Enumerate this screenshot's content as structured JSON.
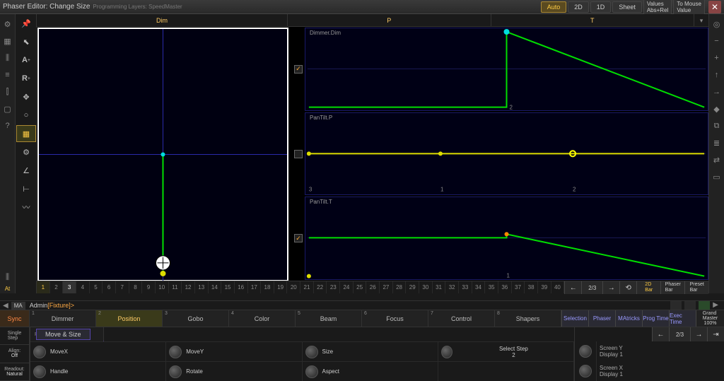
{
  "titlebar": {
    "title": "Phaser Editor: Change Size",
    "subtitle": "Programming Layers: SpeedMaster",
    "auto": "Auto",
    "btn_2d": "2D",
    "btn_1d": "1D",
    "btn_sheet": "Sheet",
    "values": "Values",
    "absrel": "Abs+Rel",
    "tomouse": "To Mouse",
    "value": "Value",
    "close": "✕"
  },
  "left_icons": {
    "at": "At"
  },
  "tool_icons": {
    "a": "A",
    "r": "R"
  },
  "tabs": {
    "dim": "Dim",
    "p": "P",
    "t": "T"
  },
  "graphs": {
    "dimmer": "Dimmer.Dim",
    "pantilt_p": "PanTilt.P",
    "pantilt_t": "PanTilt.T"
  },
  "timeline": {
    "page": "2/3",
    "bar_2d": "2D\nBar",
    "bar_phaser": "Phaser\nBar",
    "bar_preset": "Preset\nBar"
  },
  "cmd": {
    "ma": "MA",
    "admin": "Admin",
    "fixture": "[Fixture]>"
  },
  "attrs": {
    "sync": "Sync",
    "dimmer": "Dimmer",
    "position": "Position",
    "gobo": "Gobo",
    "color": "Color",
    "beam": "Beam",
    "focus": "Focus",
    "control": "Control",
    "shapers": "Shapers",
    "selection": "Selection",
    "phaser": "Phaser",
    "matricks": "MAtricks",
    "progtime": "Prog Time",
    "exectime": "Exec Time",
    "grandmaster": "Grand\nMaster",
    "gm_val": "100%"
  },
  "single_step": {
    "lbl": "Single\nStep",
    "align": "Align:",
    "align_v": "Off",
    "readout": "Readout:",
    "readout_v": "Natural"
  },
  "movesize": {
    "pages": "Pages",
    "tab": "Move & Size"
  },
  "encoders": {
    "movex": "MoveX",
    "movex_v": "",
    "movey": "MoveY",
    "movey_v": "",
    "size": "Size",
    "size_v": "",
    "handle": "Handle",
    "handle_v": "",
    "rotate": "Rotate",
    "rotate_v": "",
    "aspect": "Aspect",
    "aspect_v": "",
    "select_step": "Select Step",
    "select_step_v": "2"
  },
  "encnav": {
    "page": "2/3",
    "screeny": "Screen Y",
    "display1": "Display 1",
    "screenx": "Screen X"
  },
  "chart_data": [
    {
      "name": "2D-Dim-view",
      "type": "scatter",
      "title": "Dim",
      "xlim": [
        -1,
        1
      ],
      "ylim": [
        -1,
        1
      ],
      "series": [
        {
          "name": "path",
          "x": [
            0,
            0
          ],
          "y": [
            0,
            -0.95
          ]
        },
        {
          "name": "cursor",
          "x": [
            0
          ],
          "y": [
            -0.85
          ]
        }
      ]
    },
    {
      "name": "Dimmer.Dim",
      "type": "line",
      "xlim": [
        0,
        3
      ],
      "ylim": [
        0,
        1
      ],
      "x": [
        0,
        1.5,
        1.5,
        3
      ],
      "y": [
        0.02,
        0.02,
        1.0,
        0.03
      ]
    },
    {
      "name": "PanTilt.P",
      "type": "line",
      "xlim": [
        0,
        3
      ],
      "ylim": [
        0,
        1
      ],
      "x": [
        0,
        3
      ],
      "y": [
        0.5,
        0.5
      ],
      "markers_x": [
        0,
        1,
        2
      ],
      "axis_labels": [
        "3",
        "1",
        "2"
      ]
    },
    {
      "name": "PanTilt.T",
      "type": "line",
      "xlim": [
        0,
        3
      ],
      "ylim": [
        0,
        1
      ],
      "x": [
        0,
        1.5,
        1.5,
        3
      ],
      "y": [
        0.5,
        0.5,
        0.55,
        0.03
      ],
      "markers_x": [
        1.5
      ]
    }
  ]
}
